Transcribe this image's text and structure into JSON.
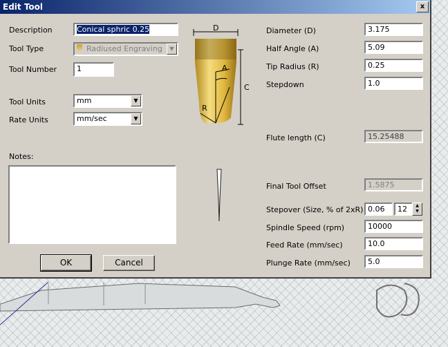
{
  "window": {
    "title": "Edit Tool",
    "close_glyph": "x"
  },
  "form": {
    "description_label": "Description",
    "description_value": "Conical sphric 0.25",
    "tool_type_label": "Tool Type",
    "tool_type_value": "Radiused Engraving",
    "tool_number_label": "Tool Number",
    "tool_number_value": "1",
    "tool_units_label": "Tool Units",
    "tool_units_value": "mm",
    "rate_units_label": "Rate Units",
    "rate_units_value": "mm/sec",
    "notes_label": "Notes:",
    "notes_value": ""
  },
  "diagram": {
    "d_label": "D",
    "a_label": "A",
    "c_label": "C",
    "r_label": "R"
  },
  "params": {
    "diameter_label": "Diameter (D)",
    "diameter_value": "3.175",
    "half_angle_label": "Half Angle (A)",
    "half_angle_value": "5.09",
    "tip_radius_label": "Tip Radius (R)",
    "tip_radius_value": "0.25",
    "stepdown_label": "Stepdown",
    "stepdown_value": "1.0",
    "flute_length_label": "Flute length (C)",
    "flute_length_value": "15.25488",
    "final_offset_label": "Final Tool Offset",
    "final_offset_value": "1.5875",
    "stepover_label": "Stepover (Size, % of 2xR)",
    "stepover_size": "0.06",
    "stepover_percent": "12",
    "spindle_label": "Spindle Speed (rpm)",
    "spindle_value": "10000",
    "feed_label": "Feed Rate (mm/sec)",
    "feed_value": "10.0",
    "plunge_label": "Plunge Rate (mm/sec)",
    "plunge_value": "5.0"
  },
  "buttons": {
    "ok": "OK",
    "cancel": "Cancel"
  },
  "colors": {
    "title_start": "#0a246a",
    "title_end": "#a6caf0",
    "face": "#d4d0c8",
    "tool_gold": "#e8c040"
  }
}
